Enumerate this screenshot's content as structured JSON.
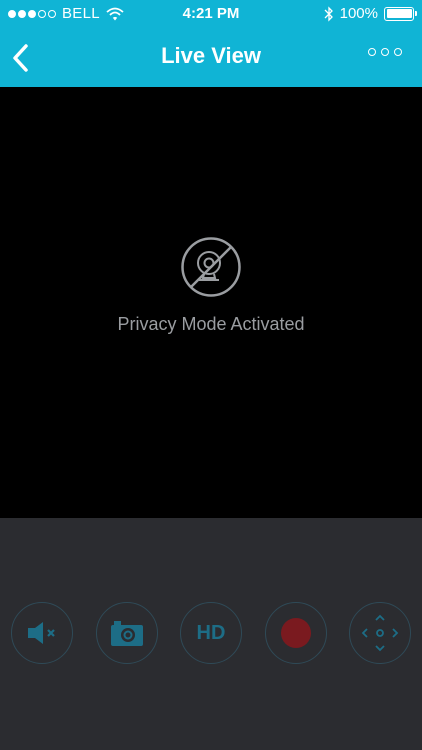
{
  "status": {
    "carrier": "BELL",
    "time": "4:21 PM",
    "battery": "100%",
    "signal_bars_filled": 3,
    "signal_bars_total": 5
  },
  "nav": {
    "title": "Live View"
  },
  "video": {
    "privacy_text": "Privacy Mode Activated"
  },
  "controls": {
    "hd_label": "HD"
  },
  "colors": {
    "header": "#10b4d5",
    "control_bg": "#2b2c30",
    "control_icon": "#1d6d86",
    "record": "#7a1a1f"
  },
  "icons": [
    "back-chevron-icon",
    "more-options-icon",
    "privacy-camera-off-icon",
    "mute-icon",
    "camera-icon",
    "record-icon",
    "pan-tilt-icon"
  ]
}
